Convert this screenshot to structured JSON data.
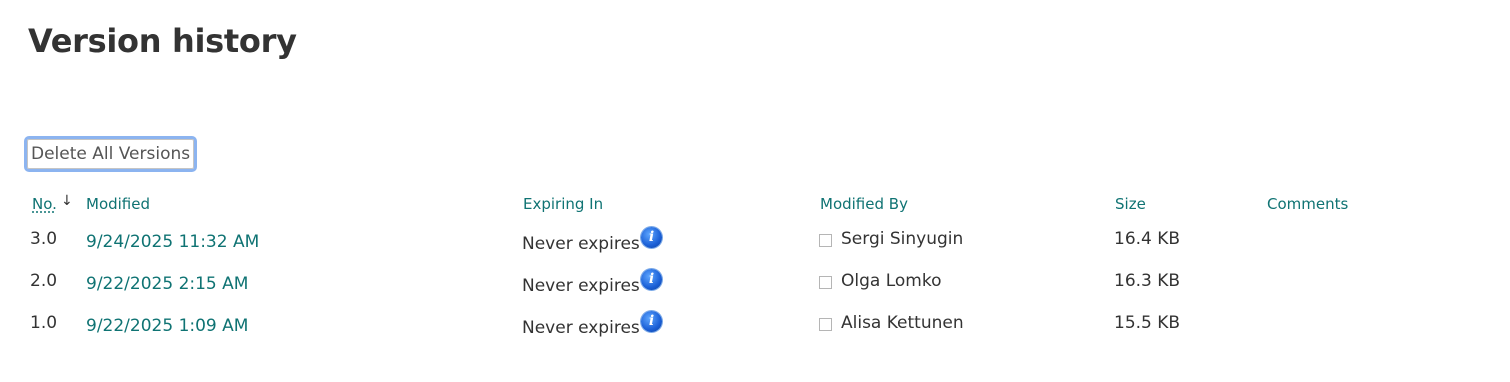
{
  "page": {
    "title": "Version history"
  },
  "toolbar": {
    "delete_all_label": "Delete All Versions"
  },
  "table": {
    "columns": {
      "no": "No.",
      "sort_indicator": "↓",
      "modified": "Modified",
      "expiring_in": "Expiring In",
      "modified_by": "Modified By",
      "size": "Size",
      "comments": "Comments"
    },
    "rows": [
      {
        "no": "3.0",
        "modified": "9/24/2025 11:32 AM",
        "expiring_in": "Never expires",
        "modified_by": "Sergi Sinyugin",
        "size": "16.4 KB",
        "comments": ""
      },
      {
        "no": "2.0",
        "modified": "9/22/2025 2:15 AM",
        "expiring_in": "Never expires",
        "modified_by": "Olga Lomko",
        "size": "16.3 KB",
        "comments": ""
      },
      {
        "no": "1.0",
        "modified": "9/22/2025 1:09 AM",
        "expiring_in": "Never expires",
        "modified_by": "Alisa Kettunen",
        "size": "15.5 KB",
        "comments": ""
      }
    ]
  },
  "icons": {
    "info": "info-icon",
    "sort": "arrow-down-icon",
    "checkbox": "checkbox-icon"
  },
  "colors": {
    "link": "#0f7373",
    "text": "#333333",
    "button_focus_border": "#8cb4f0",
    "info_icon": "#1a5fd6"
  }
}
